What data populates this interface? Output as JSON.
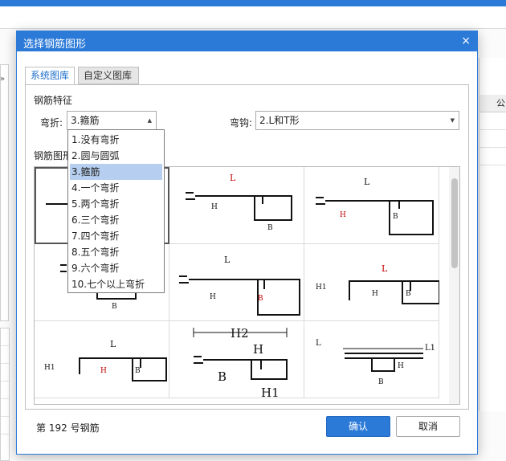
{
  "dialog": {
    "title": "选择钢筋图形",
    "close_glyph": "×",
    "tabs": [
      {
        "label": "系统图库",
        "active": true
      },
      {
        "label": "自定义图库",
        "active": false
      }
    ],
    "feature_label": "钢筋特征",
    "bend_label": "弯折:",
    "bend_value": "3.箍筋",
    "hook_label": "弯钩:",
    "hook_value": "2.L和T形",
    "shape_label": "钢筋图形",
    "status_prefix": "第",
    "status_number": "192",
    "status_suffix": "号钢筋",
    "ok_label": "确认",
    "cancel_label": "取消",
    "accent_color": "#2b7ad8"
  },
  "bend_options": [
    "1.没有弯折",
    "2.圆与圆弧",
    "3.箍筋",
    "4.一个弯折",
    "5.两个弯折",
    "6.三个弯折",
    "7.四个弯折",
    "8.五个弯折",
    "9.六个弯折",
    "10.七个以上弯折"
  ],
  "bend_selected_index": 2,
  "shape_labels": {
    "L": "L",
    "H": "H",
    "B": "B",
    "H1": "H1",
    "H2": "H2",
    "L1": "L1"
  },
  "background": {
    "scroll_arrows": "»",
    "right_header": "公"
  }
}
